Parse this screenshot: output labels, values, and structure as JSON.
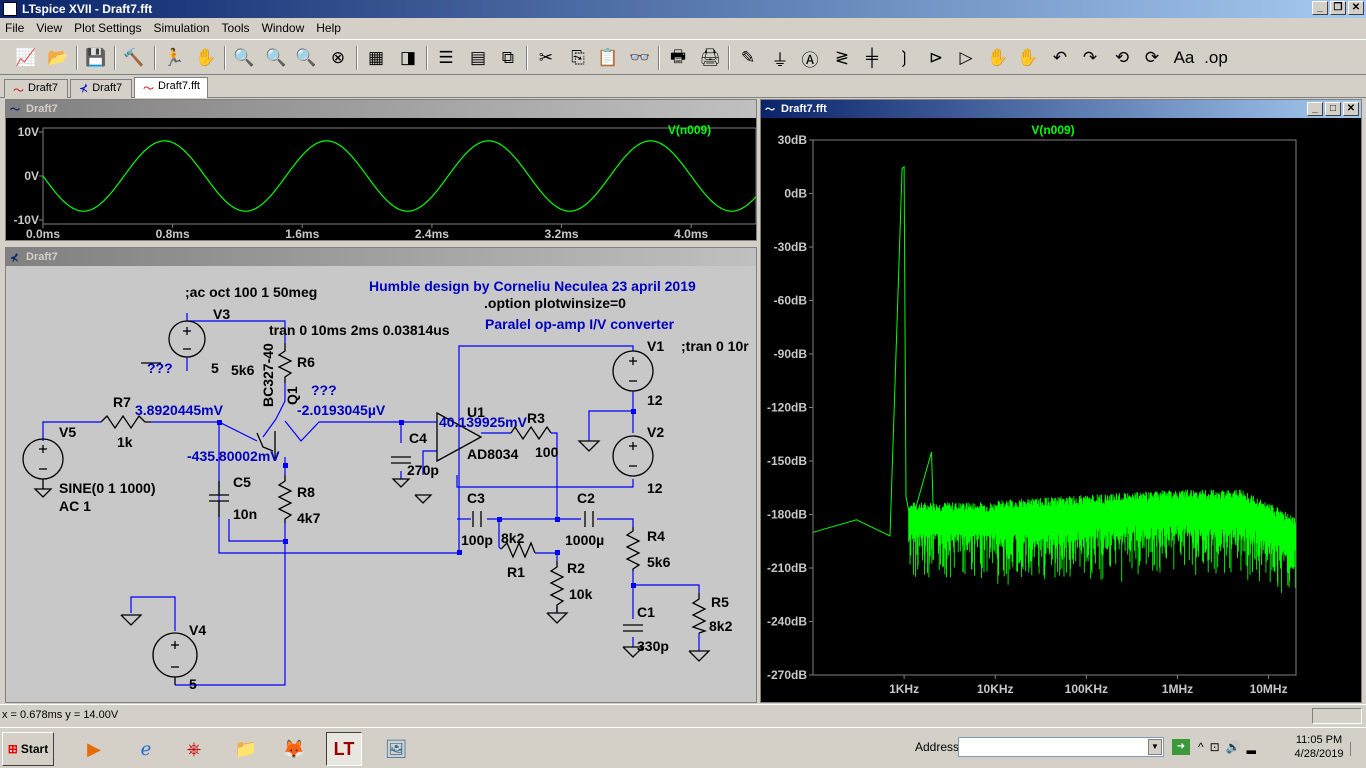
{
  "app": {
    "title": "LTspice XVII - Draft7.fft"
  },
  "menu": [
    "File",
    "View",
    "Plot Settings",
    "Simulation",
    "Tools",
    "Window",
    "Help"
  ],
  "tabs": [
    {
      "label": "Draft7"
    },
    {
      "label": "Draft7"
    },
    {
      "label": "Draft7.fft"
    }
  ],
  "wave_window": {
    "title": "Draft7",
    "trace": "V(n009)",
    "y_ticks": [
      "10V",
      "0V",
      "-10V"
    ],
    "x_ticks": [
      "0.0ms",
      "0.8ms",
      "1.6ms",
      "2.4ms",
      "3.2ms",
      "4.0ms"
    ]
  },
  "schematic_window": {
    "title": "Draft7",
    "texts": {
      "ac_cmd": ";ac oct 100 1 50meg",
      "title_note": "Humble design by Corneliu Neculea 23 april 2019",
      "option": ".option plotwinsize=0",
      "tran": "tran 0 10ms 2ms 0.03814us",
      "subtitle": "Paralel op-amp I/V converter",
      "tran2": ";tran 0 10r"
    },
    "components": {
      "V3": "V3",
      "V3_val": "5",
      "R6": "R6",
      "R6_val": "5k6",
      "Q1": "Q1",
      "Q1_model": "BC327-40",
      "q_mark1": "???",
      "q_mark2": "???",
      "V1": "V1",
      "V1_val": "12",
      "V2": "V2",
      "V2_val": "12",
      "R7": "R7",
      "R7_val": "1k",
      "V5": "V5",
      "V5_val1": "SINE(0 1 1000)",
      "V5_val2": "AC 1",
      "C4": "C4",
      "C4_val": "270p",
      "U1": "U1",
      "U1_model": "AD8034",
      "R3": "R3",
      "R3_val": "100",
      "C5": "C5",
      "C5_val": "10n",
      "R8": "R8",
      "R8_val": "4k7",
      "C3": "C3",
      "C3_val": "100p",
      "R1": "R1",
      "R1_val": "8k2",
      "C2": "C2",
      "C2_val": "1000µ",
      "R2": "R2",
      "R2_val": "10k",
      "R4": "R4",
      "R4_val": "5k6",
      "R5": "R5",
      "R5_val": "8k2",
      "C1": "C1",
      "C1_val": "330p",
      "V4": "V4",
      "V4_val": "5"
    },
    "node_voltages": {
      "n1": "3.8920445mV",
      "n2": "-2.0193045µV",
      "n3": "40.139925mV",
      "n4": "-435.80002mV"
    }
  },
  "fft_window": {
    "title": "Draft7.fft",
    "trace": "V(n009)",
    "y_ticks": [
      "30dB",
      "0dB",
      "-30dB",
      "-60dB",
      "-90dB",
      "-120dB",
      "-150dB",
      "-180dB",
      "-210dB",
      "-240dB",
      "-270dB"
    ],
    "x_ticks": [
      "1KHz",
      "10KHz",
      "100KHz",
      "1MHz",
      "10MHz"
    ]
  },
  "colors": {
    "trace": "#00ff00",
    "wire": "#0000ff",
    "label_blue": "#0000c0",
    "grid_text": "#c0c0c0"
  },
  "status": {
    "text": "x = 0.678ms   y = 14.00V"
  },
  "taskbar": {
    "start": "Start",
    "address_label": "Address",
    "time": "11:05 PM",
    "date": "4/28/2019"
  },
  "chart_data": [
    {
      "type": "line",
      "title": "",
      "series": [
        {
          "name": "V(n009)",
          "x_unit": "ms",
          "frequency_hz": 1000,
          "amplitude_v": 8
        }
      ],
      "xlim": [
        0,
        4.4
      ],
      "ylim": [
        -10,
        10
      ],
      "x_ticks": [
        "0.0ms",
        "0.8ms",
        "1.6ms",
        "2.4ms",
        "3.2ms",
        "4.0ms"
      ],
      "y_ticks": [
        "10V",
        "0V",
        "-10V"
      ]
    },
    {
      "type": "line",
      "title": "",
      "series": [
        {
          "name": "V(n009)",
          "points": [
            [
              100,
              -190
            ],
            [
              300,
              -183
            ],
            [
              700,
              -192
            ],
            [
              950,
              14
            ],
            [
              1000,
              15
            ],
            [
              1050,
              -170
            ],
            [
              1200,
              -185
            ],
            [
              2000,
              -145
            ],
            [
              2100,
              -182
            ],
            [
              10000,
              -180
            ],
            [
              100000,
              -180
            ],
            [
              1000000,
              -174
            ],
            [
              5000000,
              -180
            ],
            [
              10000000,
              -188
            ],
            [
              20000000,
              -190
            ]
          ]
        }
      ],
      "x_scale": "log",
      "xlim": [
        100,
        20000000
      ],
      "ylim": [
        -270,
        30
      ],
      "x_ticks": [
        "1KHz",
        "10KHz",
        "100KHz",
        "1MHz",
        "10MHz"
      ],
      "y_ticks": [
        "30dB",
        "0dB",
        "-30dB",
        "-60dB",
        "-90dB",
        "-120dB",
        "-150dB",
        "-180dB",
        "-210dB",
        "-240dB",
        "-270dB"
      ]
    }
  ]
}
